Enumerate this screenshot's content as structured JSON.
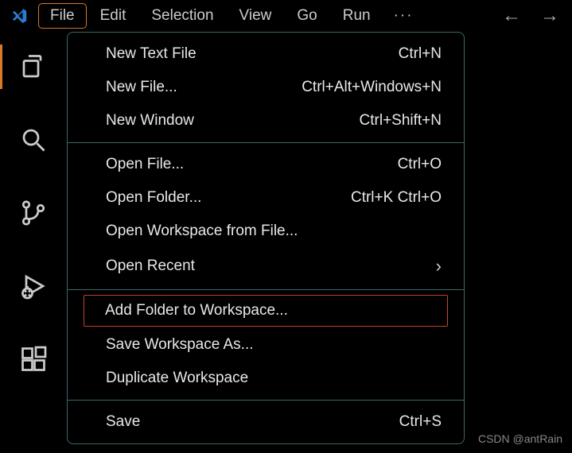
{
  "menubar": {
    "items": [
      "File",
      "Edit",
      "Selection",
      "View",
      "Go",
      "Run"
    ],
    "active_index": 0,
    "ellipsis": "···"
  },
  "nav": {
    "back": "←",
    "forward": "→"
  },
  "activitybar": {
    "items": [
      "explorer",
      "search",
      "source-control",
      "run-debug",
      "extensions"
    ],
    "active_index": 0
  },
  "dropdown": {
    "groups": [
      [
        {
          "label": "New Text File",
          "shortcut": "Ctrl+N"
        },
        {
          "label": "New File...",
          "shortcut": "Ctrl+Alt+Windows+N"
        },
        {
          "label": "New Window",
          "shortcut": "Ctrl+Shift+N"
        }
      ],
      [
        {
          "label": "Open File...",
          "shortcut": "Ctrl+O"
        },
        {
          "label": "Open Folder...",
          "shortcut": "Ctrl+K Ctrl+O"
        },
        {
          "label": "Open Workspace from File..."
        },
        {
          "label": "Open Recent",
          "submenu": true
        }
      ],
      [
        {
          "label": "Add Folder to Workspace...",
          "highlighted": true
        },
        {
          "label": "Save Workspace As..."
        },
        {
          "label": "Duplicate Workspace"
        }
      ],
      [
        {
          "label": "Save",
          "shortcut": "Ctrl+S"
        }
      ]
    ]
  },
  "watermark": "CSDN @antRain"
}
